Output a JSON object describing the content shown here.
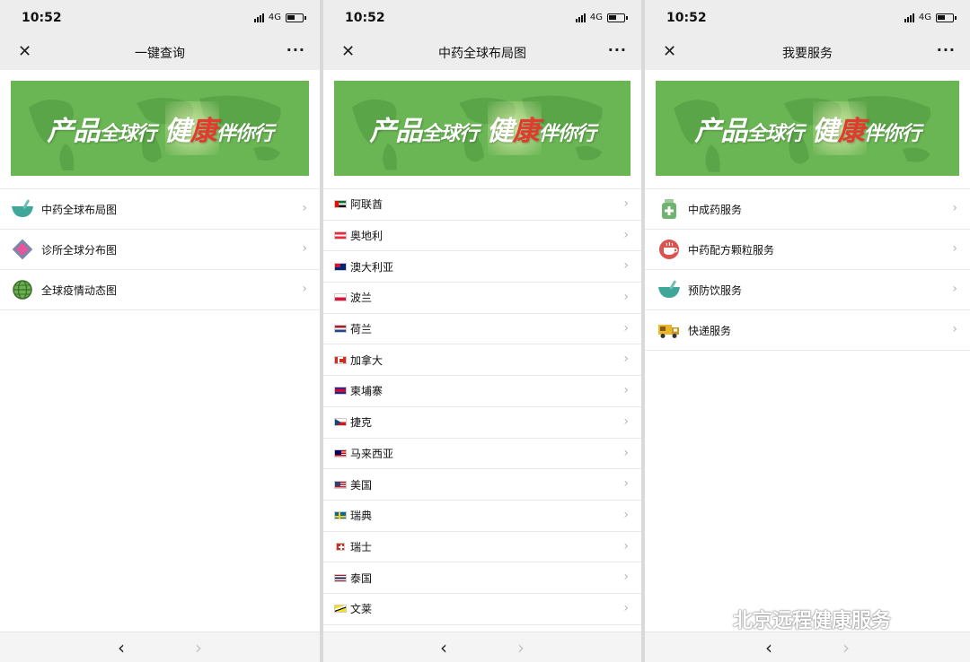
{
  "status": {
    "time": "10:52",
    "network": "4G"
  },
  "banner": {
    "part1": "产品",
    "part2": "全球行",
    "part3": "健",
    "part4": "康",
    "part5": "伴你行"
  },
  "screen1": {
    "title": "一键查询",
    "items": [
      {
        "label": "中药全球布局图",
        "icon": "mortar-bowl-icon"
      },
      {
        "label": "诊所全球分布图",
        "icon": "clinic-cross-icon"
      },
      {
        "label": "全球疫情动态图",
        "icon": "globe-icon"
      }
    ]
  },
  "screen2": {
    "title": "中药全球布局图",
    "items": [
      {
        "label": "阿联酋",
        "flag": "uae"
      },
      {
        "label": "奥地利",
        "flag": "austria"
      },
      {
        "label": "澳大利亚",
        "flag": "australia"
      },
      {
        "label": "波兰",
        "flag": "poland"
      },
      {
        "label": "荷兰",
        "flag": "netherlands"
      },
      {
        "label": "加拿大",
        "flag": "canada"
      },
      {
        "label": "柬埔寨",
        "flag": "cambodia"
      },
      {
        "label": "捷克",
        "flag": "czech"
      },
      {
        "label": "马来西亚",
        "flag": "malaysia"
      },
      {
        "label": "美国",
        "flag": "usa"
      },
      {
        "label": "瑞典",
        "flag": "sweden"
      },
      {
        "label": "瑞士",
        "flag": "switzerland"
      },
      {
        "label": "泰国",
        "flag": "thailand"
      },
      {
        "label": "文莱",
        "flag": "brunei"
      }
    ]
  },
  "screen3": {
    "title": "我要服务",
    "items": [
      {
        "label": "中成药服务",
        "icon": "medicine-bottle-icon"
      },
      {
        "label": "中药配方颗粒服务",
        "icon": "herbal-cup-icon"
      },
      {
        "label": "预防饮服务",
        "icon": "mortar-bowl-icon"
      },
      {
        "label": "快递服务",
        "icon": "delivery-truck-icon"
      }
    ]
  },
  "watermark": "北京远程健康服务",
  "colors": {
    "banner": "#6ab554",
    "accent_red": "#e23b2e",
    "nav_bg": "#ededed"
  }
}
